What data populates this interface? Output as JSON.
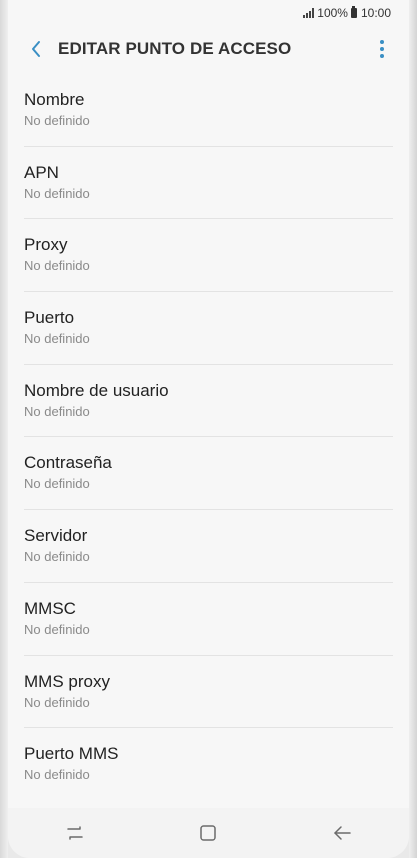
{
  "status_bar": {
    "signal_icon": "signal-bars-icon",
    "battery_percent": "100%",
    "battery_icon": "battery-icon",
    "time": "10:00"
  },
  "app_bar": {
    "title": "EDITAR PUNTO DE ACCESO",
    "back_icon": "back-chevron-icon",
    "more_icon": "more-vert-icon",
    "accent_color": "#3a8fc4"
  },
  "list": {
    "items": [
      {
        "title": "Nombre",
        "value": "No definido"
      },
      {
        "title": "APN",
        "value": "No definido"
      },
      {
        "title": "Proxy",
        "value": "No definido"
      },
      {
        "title": "Puerto",
        "value": "No definido"
      },
      {
        "title": "Nombre de usuario",
        "value": "No definido"
      },
      {
        "title": "Contraseña",
        "value": "No definido"
      },
      {
        "title": "Servidor",
        "value": "No definido"
      },
      {
        "title": "MMSC",
        "value": "No definido"
      },
      {
        "title": "MMS proxy",
        "value": "No definido"
      },
      {
        "title": "Puerto MMS",
        "value": "No definido"
      }
    ]
  },
  "nav_bar": {
    "recent_icon": "recent-apps-icon",
    "home_icon": "home-icon",
    "back_icon": "nav-back-arrow-icon"
  }
}
